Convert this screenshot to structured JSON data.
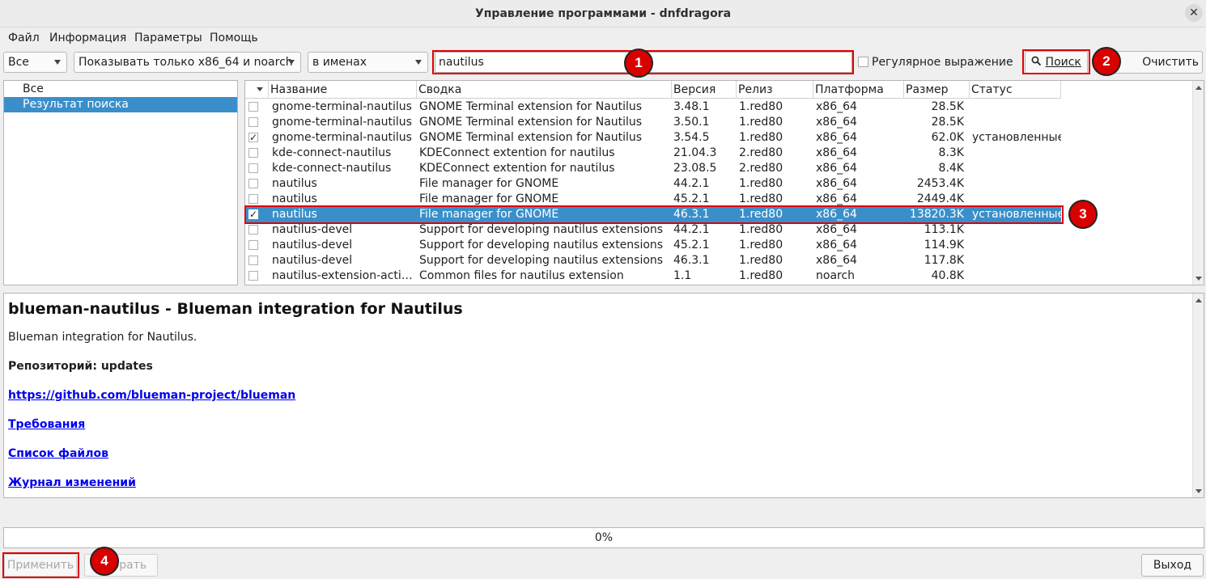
{
  "window": {
    "title": "Управление программами - dnfdragora",
    "close_glyph": "✕"
  },
  "menu": [
    "Файл",
    "Информация",
    "Параметры",
    "Помощь"
  ],
  "toolbar": {
    "filter_all": "Все",
    "arch_filter": "Показывать только x86_64 и noarch",
    "search_in": "в именах",
    "search_value": "nautilus",
    "regex_label": "Регулярное выражение",
    "search_button": "Поиск",
    "clear_button": "Очистить поиск"
  },
  "groups": [
    {
      "label": "Все",
      "selected": false
    },
    {
      "label": "Результат поиска",
      "selected": true
    }
  ],
  "columns": [
    "Название",
    "Сводка",
    "Версия",
    "Релиз",
    "Платформа",
    "Размер",
    "Статус"
  ],
  "packages": [
    {
      "checked": false,
      "name": "gnome-terminal-nautilus",
      "summary": "GNOME Terminal extension for Nautilus",
      "version": "3.48.1",
      "release": "1.red80",
      "platform": "x86_64",
      "size": "28.5K",
      "status": ""
    },
    {
      "checked": false,
      "name": "gnome-terminal-nautilus",
      "summary": "GNOME Terminal extension for Nautilus",
      "version": "3.50.1",
      "release": "1.red80",
      "platform": "x86_64",
      "size": "28.5K",
      "status": ""
    },
    {
      "checked": true,
      "name": "gnome-terminal-nautilus",
      "summary": "GNOME Terminal extension for Nautilus",
      "version": "3.54.5",
      "release": "1.red80",
      "platform": "x86_64",
      "size": "62.0K",
      "status": "установленные"
    },
    {
      "checked": false,
      "name": "kde-connect-nautilus",
      "summary": "KDEConnect extention for nautilus",
      "version": "21.04.3",
      "release": "2.red80",
      "platform": "x86_64",
      "size": "8.3K",
      "status": ""
    },
    {
      "checked": false,
      "name": "kde-connect-nautilus",
      "summary": "KDEConnect extention for nautilus",
      "version": "23.08.5",
      "release": "2.red80",
      "platform": "x86_64",
      "size": "8.4K",
      "status": ""
    },
    {
      "checked": false,
      "name": "nautilus",
      "summary": "File manager for GNOME",
      "version": "44.2.1",
      "release": "1.red80",
      "platform": "x86_64",
      "size": "2453.4K",
      "status": ""
    },
    {
      "checked": false,
      "name": "nautilus",
      "summary": "File manager for GNOME",
      "version": "45.2.1",
      "release": "1.red80",
      "platform": "x86_64",
      "size": "2449.4K",
      "status": ""
    },
    {
      "checked": true,
      "selected": true,
      "name": "nautilus",
      "summary": "File manager for GNOME",
      "version": "46.3.1",
      "release": "1.red80",
      "platform": "x86_64",
      "size": "13820.3K",
      "status": "установленные"
    },
    {
      "checked": false,
      "name": "nautilus-devel",
      "summary": "Support for developing nautilus extensions",
      "version": "44.2.1",
      "release": "1.red80",
      "platform": "x86_64",
      "size": "113.1K",
      "status": ""
    },
    {
      "checked": false,
      "name": "nautilus-devel",
      "summary": "Support for developing nautilus extensions",
      "version": "45.2.1",
      "release": "1.red80",
      "platform": "x86_64",
      "size": "114.9K",
      "status": ""
    },
    {
      "checked": false,
      "name": "nautilus-devel",
      "summary": "Support for developing nautilus extensions",
      "version": "46.3.1",
      "release": "1.red80",
      "platform": "x86_64",
      "size": "117.8K",
      "status": ""
    },
    {
      "checked": false,
      "name": "nautilus-extension-acti…",
      "summary": "Common files for nautilus extension",
      "version": "1.1",
      "release": "1.red80",
      "platform": "noarch",
      "size": "40.8K",
      "status": ""
    }
  ],
  "details": {
    "title": "blueman-nautilus - Blueman integration for Nautilus",
    "description": "Blueman integration for Nautilus.",
    "repo": "Репозиторий: updates",
    "url": "https://github.com/blueman-project/blueman",
    "requirements": "Требования",
    "files": "Список файлов",
    "changelog": "Журнал изменений"
  },
  "progress": "0%",
  "footer": {
    "apply": "Применить",
    "select_all": "Выбрать все",
    "exit": "Выход"
  },
  "annotations": [
    "1",
    "2",
    "3",
    "4"
  ],
  "colors": {
    "selection": "#3a8fca",
    "highlight_box": "#e00000",
    "badge": "#d90000"
  }
}
